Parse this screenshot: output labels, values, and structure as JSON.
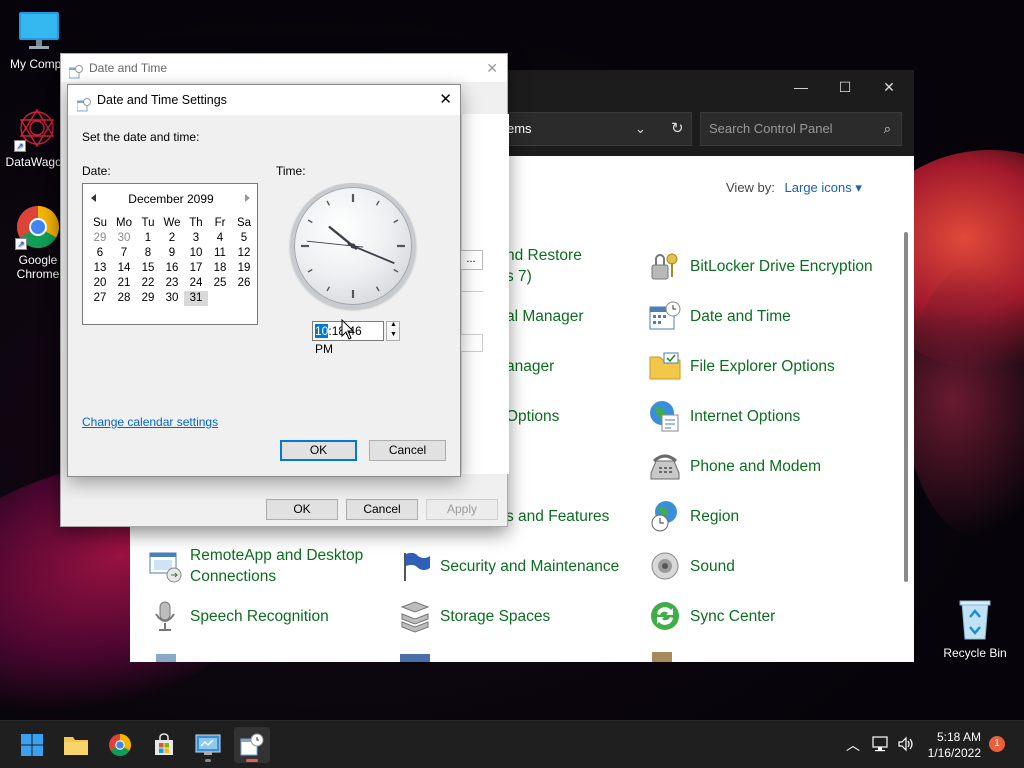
{
  "desktop": {
    "icons": [
      {
        "label": "My Compu"
      },
      {
        "label": "DataWagon"
      },
      {
        "label": "Google Chrome"
      },
      {
        "label": "Recycle Bin"
      }
    ]
  },
  "control_panel": {
    "address_text": "ems",
    "search_placeholder": "Search Control Panel",
    "view_by_label": "View by:",
    "view_by_value": "Large icons",
    "items": [
      {
        "label": "nd Restore\ns 7)",
        "icon": "backup-icon"
      },
      {
        "label": "BitLocker Drive Encryption",
        "icon": "bitlocker-key-icon"
      },
      {
        "label": "al Manager",
        "icon": "credential-icon"
      },
      {
        "label": "Date and Time",
        "icon": "calendar-clock-icon"
      },
      {
        "label": "anager",
        "icon": "device-icon"
      },
      {
        "label": "File Explorer Options",
        "icon": "folder-icon"
      },
      {
        "label": "Options",
        "icon": "options-icon"
      },
      {
        "label": "Internet Options",
        "icon": "globe-icon"
      },
      {
        "label": "Phone and Modem",
        "icon": "phone-icon"
      },
      {
        "label": "s and Features",
        "icon": "programs-icon"
      },
      {
        "label": "Region",
        "icon": "region-icon"
      },
      {
        "label": "RemoteApp and Desktop\nConnections",
        "icon": "remoteapp-icon"
      },
      {
        "label": "Security and Maintenance",
        "icon": "flag-icon"
      },
      {
        "label": "Sound",
        "icon": "speaker-icon"
      },
      {
        "label": "Speech Recognition",
        "icon": "microphone-icon"
      },
      {
        "label": "Storage Spaces",
        "icon": "storage-icon"
      },
      {
        "label": "Sync Center",
        "icon": "sync-icon"
      }
    ]
  },
  "date_time_dialog": {
    "title": "Date and Time",
    "ok": "OK",
    "cancel": "Cancel",
    "apply": "Apply",
    "partial_field_text": "..."
  },
  "settings_dialog": {
    "title": "Date and Time Settings",
    "instruction": "Set the date and time:",
    "date_label": "Date:",
    "time_label": "Time:",
    "calendar": {
      "month_year": "December 2099",
      "weekdays": [
        "Su",
        "Mo",
        "Tu",
        "We",
        "Th",
        "Fr",
        "Sa"
      ],
      "weeks": [
        [
          "29",
          "30",
          "1",
          "2",
          "3",
          "4",
          "5"
        ],
        [
          "6",
          "7",
          "8",
          "9",
          "10",
          "11",
          "12"
        ],
        [
          "13",
          "14",
          "15",
          "16",
          "17",
          "18",
          "19"
        ],
        [
          "20",
          "21",
          "22",
          "23",
          "24",
          "25",
          "26"
        ],
        [
          "27",
          "28",
          "29",
          "30",
          "31",
          "",
          ""
        ]
      ],
      "selected_day": "31"
    },
    "time": {
      "hour": "10",
      "rest": ":18:46 PM",
      "clock_hour": 10,
      "clock_minute": 18,
      "clock_second": 46
    },
    "change_calendar_link": "Change calendar settings",
    "ok": "OK",
    "cancel": "Cancel"
  },
  "taskbar": {
    "clock_time": "5:18 AM",
    "clock_date": "1/16/2022",
    "notification_count": "1"
  }
}
